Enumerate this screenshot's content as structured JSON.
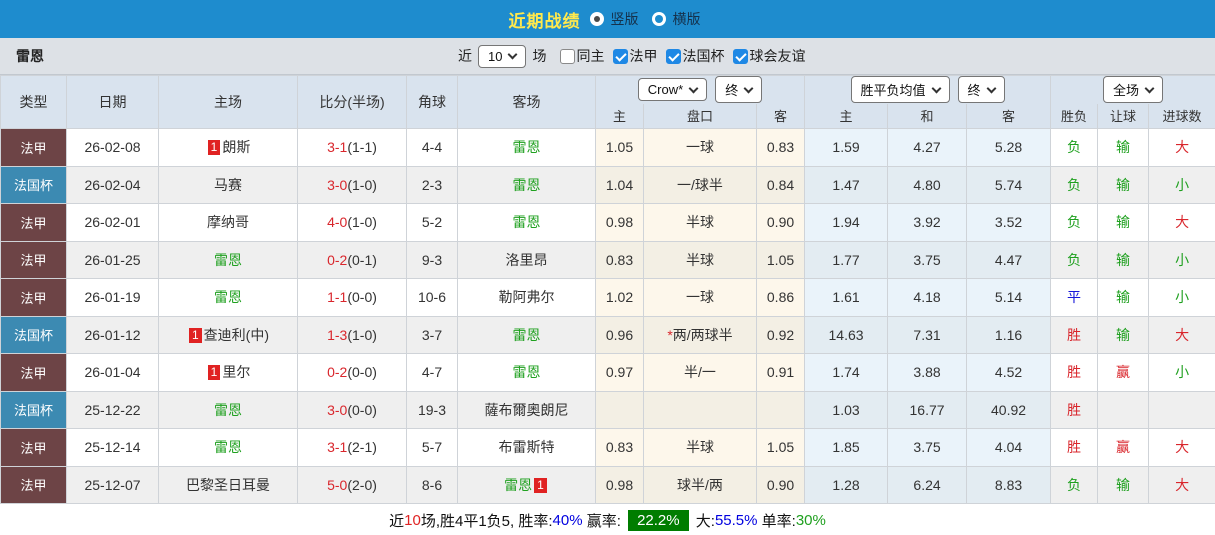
{
  "colors": {
    "topbar": "#1e8cce",
    "title_text": "#ffe94d",
    "ligue1_badge": "#6d4446",
    "cup_badge": "#3c8ab2",
    "red": "#d9262c",
    "green": "#1fa01f",
    "blue": "#1616d9",
    "checkbox_checked": "#1e88e5",
    "win_rate_bg": "#007d00"
  },
  "title_bar": {
    "title": "近期战绩",
    "radios": [
      {
        "label": "竖版",
        "selected": true
      },
      {
        "label": "横版",
        "selected": false
      }
    ]
  },
  "filter_bar": {
    "team": "雷恩",
    "near_label": "近",
    "games_value": "10",
    "games_suffix": "场",
    "checkboxes": [
      {
        "label": "同主",
        "checked": false
      },
      {
        "label": "法甲",
        "checked": true
      },
      {
        "label": "法国杯",
        "checked": true
      },
      {
        "label": "球会友谊",
        "checked": true
      }
    ]
  },
  "table": {
    "static_headers": [
      "类型",
      "日期",
      "主场",
      "比分(半场)",
      "角球",
      "客场"
    ],
    "selects": [
      {
        "label": "Crow*"
      },
      {
        "label": "终"
      },
      {
        "label": "胜平负均值"
      },
      {
        "label": "终"
      },
      {
        "label": "全场"
      }
    ],
    "sub_headers": [
      "主",
      "盘口",
      "客",
      "主",
      "和",
      "客",
      "胜负",
      "让球",
      "进球数"
    ],
    "rows": [
      {
        "type": "法甲",
        "type_key": "ligue1",
        "date": "26-02-08",
        "home": {
          "badge": "1",
          "name": "朗斯",
          "green": false
        },
        "score_ft": "3-1",
        "score_ht": "(1-1)",
        "corners": "4-4",
        "away": {
          "badge": "",
          "name": "雷恩",
          "green": true
        },
        "odds_home": "1.05",
        "handicap_star": "",
        "handicap": "一球",
        "odds_away": "0.83",
        "avg_home": "1.59",
        "avg_draw": "4.27",
        "avg_away": "5.28",
        "outcome": {
          "t": "负",
          "c": "g"
        },
        "let_result": {
          "t": "输",
          "c": "g"
        },
        "goals": {
          "t": "大",
          "c": "r"
        }
      },
      {
        "type": "法国杯",
        "type_key": "cup",
        "date": "26-02-04",
        "home": {
          "badge": "",
          "name": "马赛",
          "green": false
        },
        "score_ft": "3-0",
        "score_ht": "(1-0)",
        "corners": "2-3",
        "away": {
          "badge": "",
          "name": "雷恩",
          "green": true
        },
        "odds_home": "1.04",
        "handicap_star": "",
        "handicap": "一/球半",
        "odds_away": "0.84",
        "avg_home": "1.47",
        "avg_draw": "4.80",
        "avg_away": "5.74",
        "outcome": {
          "t": "负",
          "c": "g"
        },
        "let_result": {
          "t": "输",
          "c": "g"
        },
        "goals": {
          "t": "小",
          "c": "g"
        }
      },
      {
        "type": "法甲",
        "type_key": "ligue1",
        "date": "26-02-01",
        "home": {
          "badge": "",
          "name": "摩纳哥",
          "green": false
        },
        "score_ft": "4-0",
        "score_ht": "(1-0)",
        "corners": "5-2",
        "away": {
          "badge": "",
          "name": "雷恩",
          "green": true
        },
        "odds_home": "0.98",
        "handicap_star": "",
        "handicap": "半球",
        "odds_away": "0.90",
        "avg_home": "1.94",
        "avg_draw": "3.92",
        "avg_away": "3.52",
        "outcome": {
          "t": "负",
          "c": "g"
        },
        "let_result": {
          "t": "输",
          "c": "g"
        },
        "goals": {
          "t": "大",
          "c": "r"
        }
      },
      {
        "type": "法甲",
        "type_key": "ligue1",
        "date": "26-01-25",
        "home": {
          "badge": "",
          "name": "雷恩",
          "green": true
        },
        "score_ft": "0-2",
        "score_ht": "(0-1)",
        "corners": "9-3",
        "away": {
          "badge": "",
          "name": "洛里昂",
          "green": false
        },
        "odds_home": "0.83",
        "handicap_star": "",
        "handicap": "半球",
        "odds_away": "1.05",
        "avg_home": "1.77",
        "avg_draw": "3.75",
        "avg_away": "4.47",
        "outcome": {
          "t": "负",
          "c": "g"
        },
        "let_result": {
          "t": "输",
          "c": "g"
        },
        "goals": {
          "t": "小",
          "c": "g"
        }
      },
      {
        "type": "法甲",
        "type_key": "ligue1",
        "date": "26-01-19",
        "home": {
          "badge": "",
          "name": "雷恩",
          "green": true
        },
        "score_ft": "1-1",
        "score_ht": "(0-0)",
        "corners": "10-6",
        "away": {
          "badge": "",
          "name": "勒阿弗尔",
          "green": false
        },
        "odds_home": "1.02",
        "handicap_star": "",
        "handicap": "一球",
        "odds_away": "0.86",
        "avg_home": "1.61",
        "avg_draw": "4.18",
        "avg_away": "5.14",
        "outcome": {
          "t": "平",
          "c": "b"
        },
        "let_result": {
          "t": "输",
          "c": "g"
        },
        "goals": {
          "t": "小",
          "c": "g"
        }
      },
      {
        "type": "法国杯",
        "type_key": "cup",
        "date": "26-01-12",
        "home": {
          "badge": "1",
          "name": "查迪利(中)",
          "green": false
        },
        "score_ft": "1-3",
        "score_ht": "(1-0)",
        "corners": "3-7",
        "away": {
          "badge": "",
          "name": "雷恩",
          "green": true
        },
        "odds_home": "0.96",
        "handicap_star": "*",
        "handicap": "两/两球半",
        "odds_away": "0.92",
        "avg_home": "14.63",
        "avg_draw": "7.31",
        "avg_away": "1.16",
        "outcome": {
          "t": "胜",
          "c": "r"
        },
        "let_result": {
          "t": "输",
          "c": "g"
        },
        "goals": {
          "t": "大",
          "c": "r"
        }
      },
      {
        "type": "法甲",
        "type_key": "ligue1",
        "date": "26-01-04",
        "home": {
          "badge": "1",
          "name": "里尔",
          "green": false
        },
        "score_ft": "0-2",
        "score_ht": "(0-0)",
        "corners": "4-7",
        "away": {
          "badge": "",
          "name": "雷恩",
          "green": true
        },
        "odds_home": "0.97",
        "handicap_star": "",
        "handicap": "半/一",
        "odds_away": "0.91",
        "avg_home": "1.74",
        "avg_draw": "3.88",
        "avg_away": "4.52",
        "outcome": {
          "t": "胜",
          "c": "r"
        },
        "let_result": {
          "t": "赢",
          "c": "r"
        },
        "goals": {
          "t": "小",
          "c": "g"
        }
      },
      {
        "type": "法国杯",
        "type_key": "cup",
        "date": "25-12-22",
        "home": {
          "badge": "",
          "name": "雷恩",
          "green": true
        },
        "score_ft": "3-0",
        "score_ht": "(0-0)",
        "corners": "19-3",
        "away": {
          "badge": "",
          "name": "薩布爾奧朗尼",
          "green": false
        },
        "odds_home": "",
        "handicap_star": "",
        "handicap": "",
        "odds_away": "",
        "avg_home": "1.03",
        "avg_draw": "16.77",
        "avg_away": "40.92",
        "outcome": {
          "t": "胜",
          "c": "r"
        },
        "let_result": {
          "t": "",
          "c": "g"
        },
        "goals": {
          "t": "",
          "c": "g"
        }
      },
      {
        "type": "法甲",
        "type_key": "ligue1",
        "date": "25-12-14",
        "home": {
          "badge": "",
          "name": "雷恩",
          "green": true
        },
        "score_ft": "3-1",
        "score_ht": "(2-1)",
        "corners": "5-7",
        "away": {
          "badge": "",
          "name": "布雷斯特",
          "green": false
        },
        "odds_home": "0.83",
        "handicap_star": "",
        "handicap": "半球",
        "odds_away": "1.05",
        "avg_home": "1.85",
        "avg_draw": "3.75",
        "avg_away": "4.04",
        "outcome": {
          "t": "胜",
          "c": "r"
        },
        "let_result": {
          "t": "赢",
          "c": "r"
        },
        "goals": {
          "t": "大",
          "c": "r"
        }
      },
      {
        "type": "法甲",
        "type_key": "ligue1",
        "date": "25-12-07",
        "home": {
          "badge": "",
          "name": "巴黎圣日耳曼",
          "green": false
        },
        "score_ft": "5-0",
        "score_ht": "(2-0)",
        "corners": "8-6",
        "away": {
          "badge": "1",
          "name": "雷恩",
          "green": true
        },
        "odds_home": "0.98",
        "handicap_star": "",
        "handicap": "球半/两",
        "odds_away": "0.90",
        "avg_home": "1.28",
        "avg_draw": "6.24",
        "avg_away": "8.83",
        "outcome": {
          "t": "负",
          "c": "g"
        },
        "let_result": {
          "t": "输",
          "c": "g"
        },
        "goals": {
          "t": "大",
          "c": "r"
        }
      }
    ]
  },
  "summary": {
    "segments": [
      {
        "t": "近",
        "c": "k"
      },
      {
        "t": "10",
        "c": "r"
      },
      {
        "t": "场,胜4平1负5, 胜率:",
        "c": "k"
      },
      {
        "t": "40%",
        "c": "b"
      },
      {
        "t": " 赢率: ",
        "c": "k"
      },
      {
        "t": "22.2%",
        "c": "hl"
      },
      {
        "t": " 大:",
        "c": "k"
      },
      {
        "t": "55.5%",
        "c": "b"
      },
      {
        "t": " 单率:",
        "c": "k"
      },
      {
        "t": "30%",
        "c": "g"
      }
    ]
  }
}
